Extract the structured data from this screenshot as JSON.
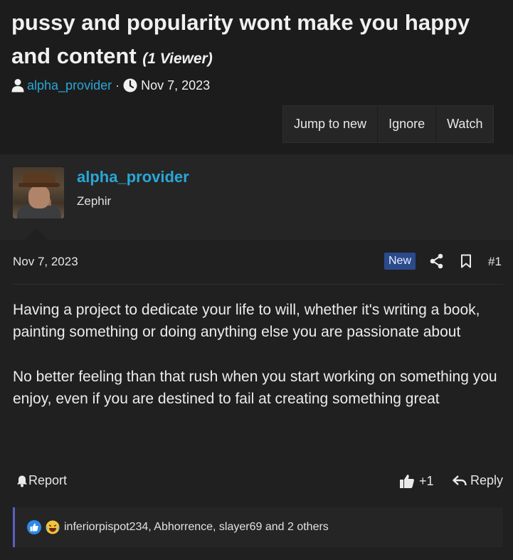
{
  "thread": {
    "title": "pussy and popularity wont make you happy and content",
    "viewers": "(1 Viewer)",
    "author": "alpha_provider",
    "separator": "·",
    "date": "Nov 7, 2023"
  },
  "toolbar": {
    "jump_label": "Jump to new",
    "ignore_label": "Ignore",
    "watch_label": "Watch"
  },
  "post": {
    "username": "alpha_provider",
    "user_title": "Zephir",
    "date": "Nov 7, 2023",
    "badge": "New",
    "number": "#1",
    "paragraphs": [
      "Having a project to dedicate your life to will, whether it's writing a book, painting something or doing anything else you are passionate about",
      "No better feeling than that rush when you start working on something you enjoy, even if you are destined to fail at creating something great"
    ],
    "report_label": "Report",
    "reaction_count": "+1",
    "reply_label": "Reply",
    "reactions_text": "inferiorpispot234, Abhorrence, slayer69 and 2 others"
  },
  "colors": {
    "accent": "#29a7d6",
    "badge_bg": "#2b4a8c",
    "reaction_border": "#5b5fc0",
    "page_bg": "#1c1c1d"
  },
  "icons": {
    "user": "user-icon",
    "clock": "clock-icon",
    "share": "share-icon",
    "bookmark": "bookmark-icon",
    "report": "bell-icon",
    "like": "thumbs-up-icon",
    "reply": "reply-icon"
  }
}
